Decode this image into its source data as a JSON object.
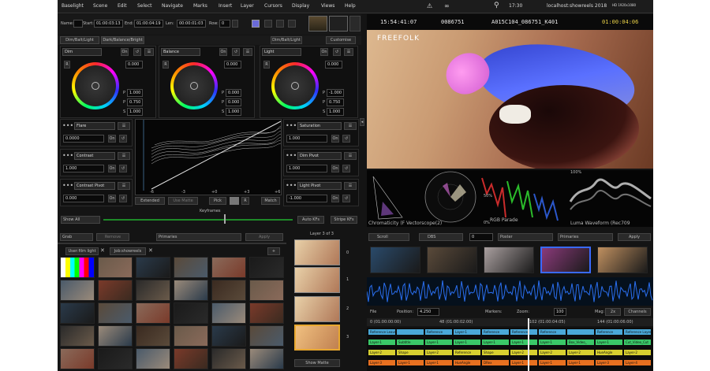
{
  "menu": [
    "Baselight",
    "Scene",
    "Edit",
    "Select",
    "Navigate",
    "Marks",
    "Insert",
    "Layer",
    "Cursors",
    "Display",
    "Views",
    "Help"
  ],
  "status": {
    "time": "17:30",
    "host": "localhost:showreels 2018",
    "fmt": "HD 1920x1080"
  },
  "shot": {
    "name_label": "Name:",
    "start_label": "Start:",
    "start": "01:00:03:13",
    "end_label": "End:",
    "end": "01:00:04:19",
    "len_label": "Len:",
    "len": "00:00:01:03",
    "row_label": "Row:",
    "row": "0"
  },
  "viewer": {
    "tc_left": "15:54:41:07",
    "frame": "0086751",
    "clip": "A015C104_086751_K401",
    "tc_right": "01:00:04:06",
    "watermark": "FREEFOLK"
  },
  "tabs": {
    "dim": "Dim/Balt/Light",
    "dark": "Dark/Balance/Bright",
    "dim2": "Dim/Balt/Light",
    "customise": "Customise"
  },
  "wheels": [
    {
      "name": "Dim",
      "vals": [
        "0.000"
      ],
      "p": "1.000",
      "p2": "0.750",
      "s": "1.000"
    },
    {
      "name": "Balance",
      "vals": [
        "0.000"
      ],
      "p": "0.000",
      "p2": "0.000",
      "s": "1.000"
    },
    {
      "name": "Light",
      "vals": [
        "0.000"
      ],
      "p": "-1.000",
      "p2": "0.750",
      "s": "1.000"
    }
  ],
  "left_params": [
    {
      "name": "Flare",
      "val": "0.0000"
    },
    {
      "name": "Contrast",
      "val": "1.000"
    },
    {
      "name": "Contrast Pivot",
      "val": "0.000"
    }
  ],
  "right_params": [
    {
      "name": "Saturation",
      "val": "1.000"
    },
    {
      "name": "Dim Pivot",
      "val": "1.000"
    },
    {
      "name": "Light Pivot",
      "val": "-1.000"
    }
  ],
  "curve_ticks": [
    "-6",
    "-3",
    "+0",
    "+3",
    "+6"
  ],
  "curve_buttons": {
    "extended": "Extended",
    "usematte": "Use Matte",
    "pick": "Pick",
    "match": "Match"
  },
  "keyframes": {
    "label": "Keyframes",
    "show_all": "Show All",
    "auto_kf": "Auto KFs",
    "stripe": "Stripe KFs"
  },
  "scopes": [
    "Chromaticity (F Vectorscope(2)",
    "RGB Parade",
    "Luma Waveform (Rec709"
  ],
  "scope_marks": [
    "100%",
    "50%",
    "0%"
  ],
  "gallery": {
    "grab": "Grab",
    "remove": "Remove",
    "primaries": "Primaries",
    "apply": "Apply",
    "tab1": "User:film light",
    "tab2": "Job:showreels"
  },
  "layers": {
    "title": "Layer 3 of 3",
    "nums": [
      "0",
      "1",
      "2",
      "3"
    ],
    "show_matte": "Show Matte"
  },
  "timeline": {
    "scroll": "Scroll",
    "dbs": "DBS",
    "dbs_val": "0",
    "poster": "Poster",
    "primaries": "Primaries",
    "apply": "Apply",
    "file_label": "File",
    "position_label": "Position:",
    "position": "4.250",
    "markers_label": "Markers:",
    "zoom_label": "Zoom:",
    "zoom": "100",
    "mag_label": "Mag:",
    "mag": "2x",
    "channels": "Channels"
  },
  "ruler": [
    "0 (01:00:00:00)",
    "48 (01:00:02:00)",
    "102 (01:00:04:05)",
    "144 (01:00:06:00)"
  ],
  "tracks": [
    [
      "Reference Leave",
      "",
      "Reference",
      "Layer-1",
      "Reference",
      "Reference",
      "Reference",
      "",
      "Reference",
      "Reference Layer-1"
    ],
    [
      "Layer-1",
      "Subtitle",
      "Layer-1",
      "Layer-1",
      "Layer-1",
      "Layer-1",
      "Layer-1",
      "Box_Video_",
      "Layer-1",
      "Cut_Video_Cut"
    ],
    [
      "Layer-2",
      "Shape",
      "Layer-2",
      "Reference",
      "Shape",
      "Layer-2",
      "Layer-2",
      "Layer-2",
      "HueAngle",
      "Layer-2"
    ],
    [
      "Layer-3",
      "Layer-1",
      "Layer-1",
      "HueAngle",
      "DRex",
      "Layer-1",
      "Layer-1",
      "Layer-1",
      "Layer-3",
      "Layer-4"
    ]
  ]
}
